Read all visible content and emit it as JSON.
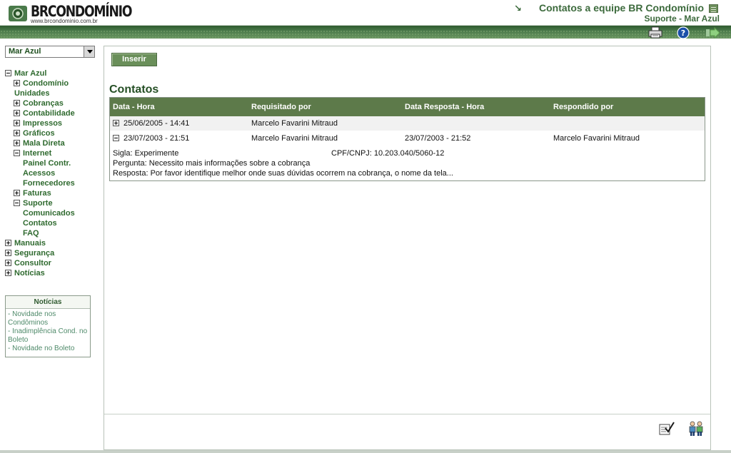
{
  "header": {
    "logo_text": "BRCONDOMÍNIO",
    "logo_url": "www.brcondominio.com.br",
    "title": "Contatos a equipe BR Condomínio",
    "subtitle": "Suporte - Mar Azul"
  },
  "toolbar": {
    "icons": [
      "printer-icon",
      "help-icon",
      "exit-arrow-icon"
    ]
  },
  "sidebar": {
    "selected_condo": "Mar Azul",
    "tree": [
      {
        "label": "Mar Azul",
        "toggle": "minus",
        "level": 0
      },
      {
        "label": "Condomínio",
        "toggle": "plus",
        "level": 1
      },
      {
        "label": "Unidades",
        "toggle": "none",
        "level": 1
      },
      {
        "label": "Cobranças",
        "toggle": "plus",
        "level": 1
      },
      {
        "label": "Contabilidade",
        "toggle": "plus",
        "level": 1
      },
      {
        "label": "Impressos",
        "toggle": "plus",
        "level": 1
      },
      {
        "label": "Gráficos",
        "toggle": "plus",
        "level": 1
      },
      {
        "label": "Mala Direta",
        "toggle": "plus",
        "level": 1
      },
      {
        "label": "Internet",
        "toggle": "minus",
        "level": 1
      },
      {
        "label": "Painel Contr.",
        "toggle": "none",
        "level": 2
      },
      {
        "label": "Acessos",
        "toggle": "none",
        "level": 2
      },
      {
        "label": "Fornecedores",
        "toggle": "none",
        "level": 2
      },
      {
        "label": "Faturas",
        "toggle": "plus",
        "level": 1
      },
      {
        "label": "Suporte",
        "toggle": "minus",
        "level": 1
      },
      {
        "label": "Comunicados",
        "toggle": "none",
        "level": 2
      },
      {
        "label": "Contatos",
        "toggle": "none",
        "level": 2
      },
      {
        "label": "FAQ",
        "toggle": "none",
        "level": 2
      },
      {
        "label": "Manuais",
        "toggle": "plus",
        "level": 0
      },
      {
        "label": "Segurança",
        "toggle": "plus",
        "level": 0
      },
      {
        "label": "Consultor",
        "toggle": "plus",
        "level": 0
      },
      {
        "label": "Notícias",
        "toggle": "plus",
        "level": 0
      }
    ],
    "news": {
      "title": "Notícias",
      "items": [
        "- Novidade nos Condôminos",
        "- Inadimplência Cond. no Boleto",
        "- Novidade no Boleto"
      ]
    }
  },
  "main": {
    "insert_label": "Inserir",
    "section_title": "Contatos",
    "columns": [
      "Data - Hora",
      "Requisitado por",
      "Data Resposta - Hora",
      "Respondido por"
    ],
    "rows": [
      {
        "toggle": "plus",
        "date": "25/06/2005 - 14:41",
        "requested_by": "Marcelo Favarini Mitraud",
        "answer_date": "",
        "answered_by": ""
      },
      {
        "toggle": "minus",
        "date": "23/07/2003 - 21:51",
        "requested_by": "Marcelo Favarini Mitraud",
        "answer_date": "23/07/2003 - 21:52",
        "answered_by": "Marcelo Favarini Mitraud"
      }
    ],
    "details": {
      "sigla": "Sigla: Experimente",
      "cpf": "CPF/CNPJ: 10.203.040/5060-12",
      "pergunta": "Pergunta: Necessito mais informações sobre a cobrança",
      "resposta": "Resposta: Por favor identifique melhor onde suas dúvidas ocorrem na cobrança, o nome da tela..."
    }
  },
  "colors": {
    "brand_green": "#3c6a3c",
    "header_band": "#4a7a4a",
    "table_header": "#5d7a4a",
    "link_green": "#2f6a2f",
    "news_link": "#4f8a6a"
  }
}
